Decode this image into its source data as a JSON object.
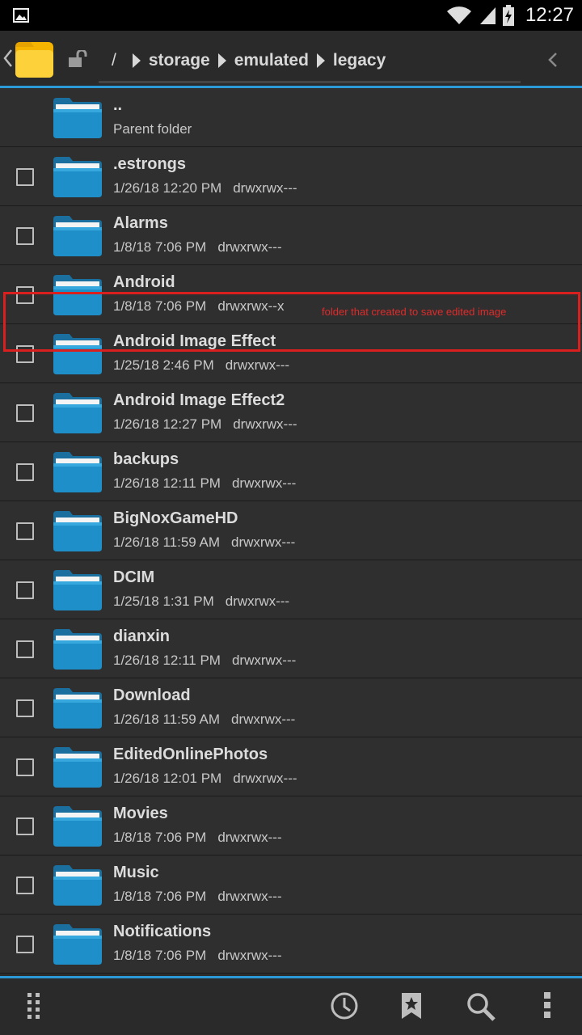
{
  "status_bar": {
    "time": "12:27",
    "icons": [
      "image-notification-icon",
      "wifi-icon",
      "signal-icon",
      "battery-charging-icon"
    ]
  },
  "toolbar": {
    "app_icon": "folder-app-icon",
    "path_root": "/",
    "breadcrumbs": [
      "storage",
      "emulated",
      "legacy"
    ]
  },
  "files": [
    {
      "name": "..",
      "meta": "Parent folder",
      "perm": ""
    },
    {
      "name": ".estrongs",
      "meta": "1/26/18 12:20 PM",
      "perm": "drwxrwx---"
    },
    {
      "name": "Alarms",
      "meta": "1/8/18 7:06 PM",
      "perm": "drwxrwx---"
    },
    {
      "name": "Android",
      "meta": "1/8/18 7:06 PM",
      "perm": "drwxrwx--x"
    },
    {
      "name": "Android Image Effect",
      "meta": "1/25/18 2:46 PM",
      "perm": "drwxrwx---"
    },
    {
      "name": "Android Image Effect2",
      "meta": "1/26/18 12:27 PM",
      "perm": "drwxrwx---"
    },
    {
      "name": "backups",
      "meta": "1/26/18 12:11 PM",
      "perm": "drwxrwx---"
    },
    {
      "name": "BigNoxGameHD",
      "meta": "1/26/18 11:59 AM",
      "perm": "drwxrwx---"
    },
    {
      "name": "DCIM",
      "meta": "1/25/18 1:31 PM",
      "perm": "drwxrwx---"
    },
    {
      "name": "dianxin",
      "meta": "1/26/18 12:11 PM",
      "perm": "drwxrwx---"
    },
    {
      "name": "Download",
      "meta": "1/26/18 11:59 AM",
      "perm": "drwxrwx---"
    },
    {
      "name": "EditedOnlinePhotos",
      "meta": "1/26/18 12:01 PM",
      "perm": "drwxrwx---"
    },
    {
      "name": "Movies",
      "meta": "1/8/18 7:06 PM",
      "perm": "drwxrwx---"
    },
    {
      "name": "Music",
      "meta": "1/8/18 7:06 PM",
      "perm": "drwxrwx---"
    },
    {
      "name": "Notifications",
      "meta": "1/8/18 7:06 PM",
      "perm": "drwxrwx---"
    }
  ],
  "annotation": {
    "text": "folder that created to save edited image",
    "color": "#e02b2b"
  },
  "bottom_bar": {
    "icons": [
      "grid-menu-icon",
      "history-clock-icon",
      "bookmark-star-icon",
      "search-icon",
      "overflow-menu-icon"
    ]
  },
  "colors": {
    "accent": "#2c9ad6",
    "folder": "#1e8fc8",
    "highlight": "#d9201e"
  }
}
